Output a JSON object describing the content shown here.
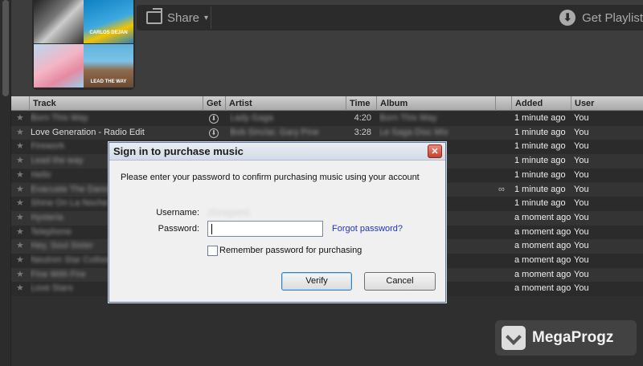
{
  "toolbar": {
    "share_label": "Share",
    "share_caret": "▾",
    "get_playlist_label": "Get Playlist"
  },
  "covers": [
    {
      "name": "album-cover-1",
      "text": ""
    },
    {
      "name": "album-cover-2",
      "text": "CARLOS DEJAN"
    },
    {
      "name": "album-cover-3",
      "text": ""
    },
    {
      "name": "album-cover-4",
      "text": "LEAD THE WAY"
    }
  ],
  "table": {
    "headers": {
      "track": "Track",
      "get": "Get",
      "artist": "Artist",
      "time": "Time",
      "album": "Album",
      "added": "Added",
      "user": "User"
    },
    "rows": [
      {
        "track": "Born This Way",
        "artist": "Lady Gaga",
        "time": "4:20",
        "album": "Born This Way",
        "added": "1 minute ago",
        "user": "You",
        "get": true
      },
      {
        "track": "Love Generation - Radio Edit",
        "artist": "Bob Sinclar, Gary Pine",
        "time": "3:28",
        "album": "Le Saga Disc Mix",
        "added": "1 minute ago",
        "user": "You",
        "get": true
      },
      {
        "track": "Firework",
        "artist": "",
        "time": "",
        "album": "",
        "added": "1 minute ago",
        "user": "You",
        "get": false
      },
      {
        "track": "Lead the way",
        "artist": "",
        "time": "",
        "album": "",
        "added": "1 minute ago",
        "user": "You",
        "get": false
      },
      {
        "track": "Hello",
        "artist": "",
        "time": "",
        "album": "",
        "added": "1 minute ago",
        "user": "You",
        "get": false
      },
      {
        "track": "Evacuate The Dancefloor",
        "artist": "",
        "time": "",
        "album": "n]",
        "added": "1 minute ago",
        "user": "You",
        "get": false
      },
      {
        "track": "Shine On La Noche",
        "artist": "",
        "time": "",
        "album": "",
        "added": "1 minute ago",
        "user": "You",
        "get": false
      },
      {
        "track": "Hysteria",
        "artist": "",
        "time": "",
        "album": "",
        "added": "a moment ago",
        "user": "You",
        "get": false
      },
      {
        "track": "Telephone",
        "artist": "",
        "time": "",
        "album": "r",
        "added": "a moment ago",
        "user": "You",
        "get": false
      },
      {
        "track": "Hey, Soul Sister",
        "artist": "",
        "time": "",
        "album": "",
        "added": "a moment ago",
        "user": "You",
        "get": false
      },
      {
        "track": "Neutron Star Collision",
        "artist": "",
        "time": "",
        "album": "sion [Lov...",
        "added": "a moment ago",
        "user": "You",
        "get": false
      },
      {
        "track": "Fine With Fire",
        "artist": "",
        "time": "",
        "album": "",
        "added": "a moment ago",
        "user": "You",
        "get": false
      },
      {
        "track": "Love Stars",
        "artist": "",
        "time": "",
        "album": "",
        "added": "a moment ago",
        "user": "You",
        "get": false
      }
    ]
  },
  "dialog": {
    "title": "Sign in to purchase music",
    "close_glyph": "✕",
    "prompt": "Please enter your password to confirm purchasing music using your account",
    "username_label": "Username:",
    "username_value": "zlocaguest",
    "password_label": "Password:",
    "password_value": "",
    "forgot_label": "Forgot password?",
    "remember_label": "Remember password for purchasing",
    "verify_label": "Verify",
    "cancel_label": "Cancel"
  },
  "watermark": {
    "text": "MegaProgz"
  },
  "icons": {
    "star": "★",
    "download": "⬇",
    "link": "∞"
  }
}
